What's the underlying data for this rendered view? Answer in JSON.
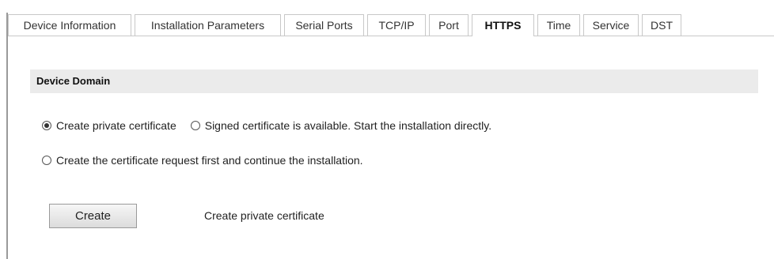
{
  "tabs": [
    {
      "label": "Device Information"
    },
    {
      "label": "Installation Parameters"
    },
    {
      "label": "Serial Ports"
    },
    {
      "label": "TCP/IP"
    },
    {
      "label": "Port"
    },
    {
      "label": "HTTPS",
      "active": true
    },
    {
      "label": "Time"
    },
    {
      "label": "Service"
    },
    {
      "label": "DST"
    }
  ],
  "section": {
    "title": "Device Domain"
  },
  "options": {
    "create_private": {
      "label": "Create private certificate",
      "checked": true
    },
    "signed_available": {
      "label": "Signed certificate is available. Start the installation directly.",
      "checked": false
    },
    "request_first": {
      "label": "Create the certificate request first and continue the installation.",
      "checked": false
    }
  },
  "action": {
    "button_label": "Create",
    "description": "Create private certificate"
  }
}
